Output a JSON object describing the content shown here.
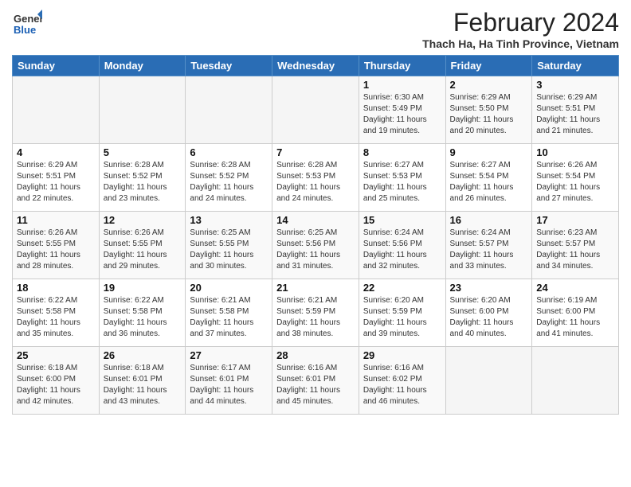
{
  "logo": {
    "general": "General",
    "blue": "Blue"
  },
  "title": {
    "month_year": "February 2024",
    "location": "Thach Ha, Ha Tinh Province, Vietnam"
  },
  "days_of_week": [
    "Sunday",
    "Monday",
    "Tuesday",
    "Wednesday",
    "Thursday",
    "Friday",
    "Saturday"
  ],
  "weeks": [
    [
      {
        "day": "",
        "info": ""
      },
      {
        "day": "",
        "info": ""
      },
      {
        "day": "",
        "info": ""
      },
      {
        "day": "",
        "info": ""
      },
      {
        "day": "1",
        "info": "Sunrise: 6:30 AM\nSunset: 5:49 PM\nDaylight: 11 hours and 19 minutes."
      },
      {
        "day": "2",
        "info": "Sunrise: 6:29 AM\nSunset: 5:50 PM\nDaylight: 11 hours and 20 minutes."
      },
      {
        "day": "3",
        "info": "Sunrise: 6:29 AM\nSunset: 5:51 PM\nDaylight: 11 hours and 21 minutes."
      }
    ],
    [
      {
        "day": "4",
        "info": "Sunrise: 6:29 AM\nSunset: 5:51 PM\nDaylight: 11 hours and 22 minutes."
      },
      {
        "day": "5",
        "info": "Sunrise: 6:28 AM\nSunset: 5:52 PM\nDaylight: 11 hours and 23 minutes."
      },
      {
        "day": "6",
        "info": "Sunrise: 6:28 AM\nSunset: 5:52 PM\nDaylight: 11 hours and 24 minutes."
      },
      {
        "day": "7",
        "info": "Sunrise: 6:28 AM\nSunset: 5:53 PM\nDaylight: 11 hours and 24 minutes."
      },
      {
        "day": "8",
        "info": "Sunrise: 6:27 AM\nSunset: 5:53 PM\nDaylight: 11 hours and 25 minutes."
      },
      {
        "day": "9",
        "info": "Sunrise: 6:27 AM\nSunset: 5:54 PM\nDaylight: 11 hours and 26 minutes."
      },
      {
        "day": "10",
        "info": "Sunrise: 6:26 AM\nSunset: 5:54 PM\nDaylight: 11 hours and 27 minutes."
      }
    ],
    [
      {
        "day": "11",
        "info": "Sunrise: 6:26 AM\nSunset: 5:55 PM\nDaylight: 11 hours and 28 minutes."
      },
      {
        "day": "12",
        "info": "Sunrise: 6:26 AM\nSunset: 5:55 PM\nDaylight: 11 hours and 29 minutes."
      },
      {
        "day": "13",
        "info": "Sunrise: 6:25 AM\nSunset: 5:55 PM\nDaylight: 11 hours and 30 minutes."
      },
      {
        "day": "14",
        "info": "Sunrise: 6:25 AM\nSunset: 5:56 PM\nDaylight: 11 hours and 31 minutes."
      },
      {
        "day": "15",
        "info": "Sunrise: 6:24 AM\nSunset: 5:56 PM\nDaylight: 11 hours and 32 minutes."
      },
      {
        "day": "16",
        "info": "Sunrise: 6:24 AM\nSunset: 5:57 PM\nDaylight: 11 hours and 33 minutes."
      },
      {
        "day": "17",
        "info": "Sunrise: 6:23 AM\nSunset: 5:57 PM\nDaylight: 11 hours and 34 minutes."
      }
    ],
    [
      {
        "day": "18",
        "info": "Sunrise: 6:22 AM\nSunset: 5:58 PM\nDaylight: 11 hours and 35 minutes."
      },
      {
        "day": "19",
        "info": "Sunrise: 6:22 AM\nSunset: 5:58 PM\nDaylight: 11 hours and 36 minutes."
      },
      {
        "day": "20",
        "info": "Sunrise: 6:21 AM\nSunset: 5:58 PM\nDaylight: 11 hours and 37 minutes."
      },
      {
        "day": "21",
        "info": "Sunrise: 6:21 AM\nSunset: 5:59 PM\nDaylight: 11 hours and 38 minutes."
      },
      {
        "day": "22",
        "info": "Sunrise: 6:20 AM\nSunset: 5:59 PM\nDaylight: 11 hours and 39 minutes."
      },
      {
        "day": "23",
        "info": "Sunrise: 6:20 AM\nSunset: 6:00 PM\nDaylight: 11 hours and 40 minutes."
      },
      {
        "day": "24",
        "info": "Sunrise: 6:19 AM\nSunset: 6:00 PM\nDaylight: 11 hours and 41 minutes."
      }
    ],
    [
      {
        "day": "25",
        "info": "Sunrise: 6:18 AM\nSunset: 6:00 PM\nDaylight: 11 hours and 42 minutes."
      },
      {
        "day": "26",
        "info": "Sunrise: 6:18 AM\nSunset: 6:01 PM\nDaylight: 11 hours and 43 minutes."
      },
      {
        "day": "27",
        "info": "Sunrise: 6:17 AM\nSunset: 6:01 PM\nDaylight: 11 hours and 44 minutes."
      },
      {
        "day": "28",
        "info": "Sunrise: 6:16 AM\nSunset: 6:01 PM\nDaylight: 11 hours and 45 minutes."
      },
      {
        "day": "29",
        "info": "Sunrise: 6:16 AM\nSunset: 6:02 PM\nDaylight: 11 hours and 46 minutes."
      },
      {
        "day": "",
        "info": ""
      },
      {
        "day": "",
        "info": ""
      }
    ]
  ]
}
